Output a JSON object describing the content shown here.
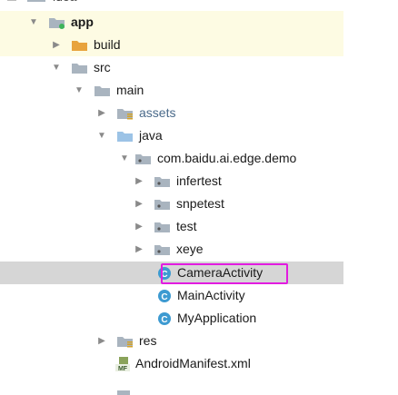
{
  "tree": {
    "header_partial": "idea",
    "app": "app",
    "build": "build",
    "src": "src",
    "main": "main",
    "assets": "assets",
    "java": "java",
    "package": "com.baidu.ai.edge.demo",
    "infertest": "infertest",
    "snpetest": "snpetest",
    "test": "test",
    "xeye": "xeye",
    "camera_activity": "CameraActivity",
    "main_activity": "MainActivity",
    "my_application": "MyApplication",
    "res": "res",
    "manifest": "AndroidManifest.xml",
    "class_badge": "C",
    "manifest_badge": "MF"
  },
  "colors": {
    "folder_gray": "#a9b4bf",
    "folder_orange": "#e8a33d",
    "folder_blue": "#9cc3e6",
    "class_circle": "#3d9ad1",
    "selection": "#d6d6d6",
    "highlight_yellow": "#fdfbe3",
    "annotation_box": "#e21ce0"
  }
}
